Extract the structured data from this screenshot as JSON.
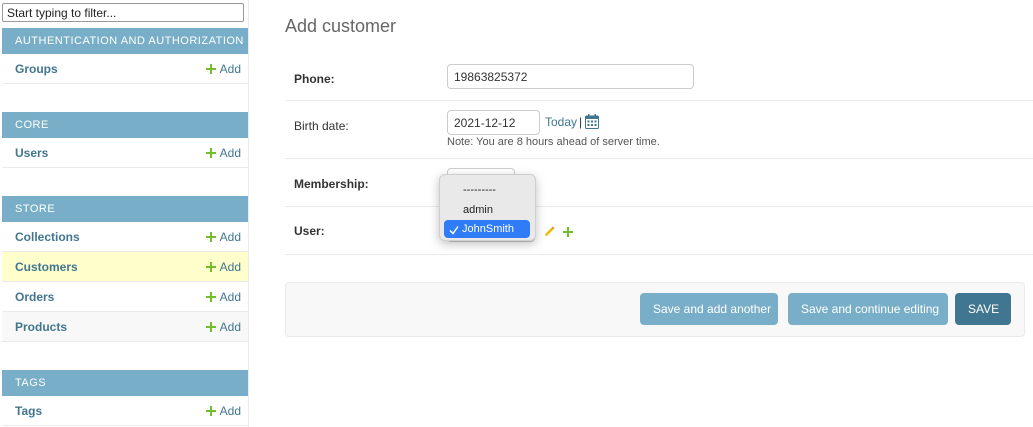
{
  "sidebar": {
    "filter_placeholder": "Start typing to filter...",
    "add_label": "Add",
    "apps": [
      {
        "name": "AUTHENTICATION AND AUTHORIZATION",
        "models": [
          "Groups"
        ]
      },
      {
        "name": "CORE",
        "models": [
          "Users"
        ]
      },
      {
        "name": "STORE",
        "models": [
          "Collections",
          "Customers",
          "Orders",
          "Products"
        ],
        "selected": "Customers"
      },
      {
        "name": "TAGS",
        "models": [
          "Tags"
        ]
      }
    ]
  },
  "main": {
    "title": "Add customer",
    "fields": {
      "phone": {
        "label": "Phone:",
        "value": "19863825372"
      },
      "birth_date": {
        "label": "Birth date:",
        "value": "2021-12-12",
        "today_label": "Today",
        "separator": "|",
        "help": "Note: You are 8 hours ahead of server time."
      },
      "membership": {
        "label": "Membership:"
      },
      "user": {
        "label": "User:",
        "options": [
          "---------",
          "admin",
          "JohnSmith"
        ],
        "selected": "JohnSmith"
      }
    },
    "buttons": {
      "save_add_another": "Save and add another",
      "save_continue": "Save and continue editing",
      "save": "SAVE"
    }
  },
  "colors": {
    "header_bg": "#79aec8",
    "link": "#417690",
    "add_plus": "#70bf2b",
    "selected_row": "#ffffcc",
    "save_button": "#417690",
    "dropdown_active": "#2f7cf6"
  }
}
